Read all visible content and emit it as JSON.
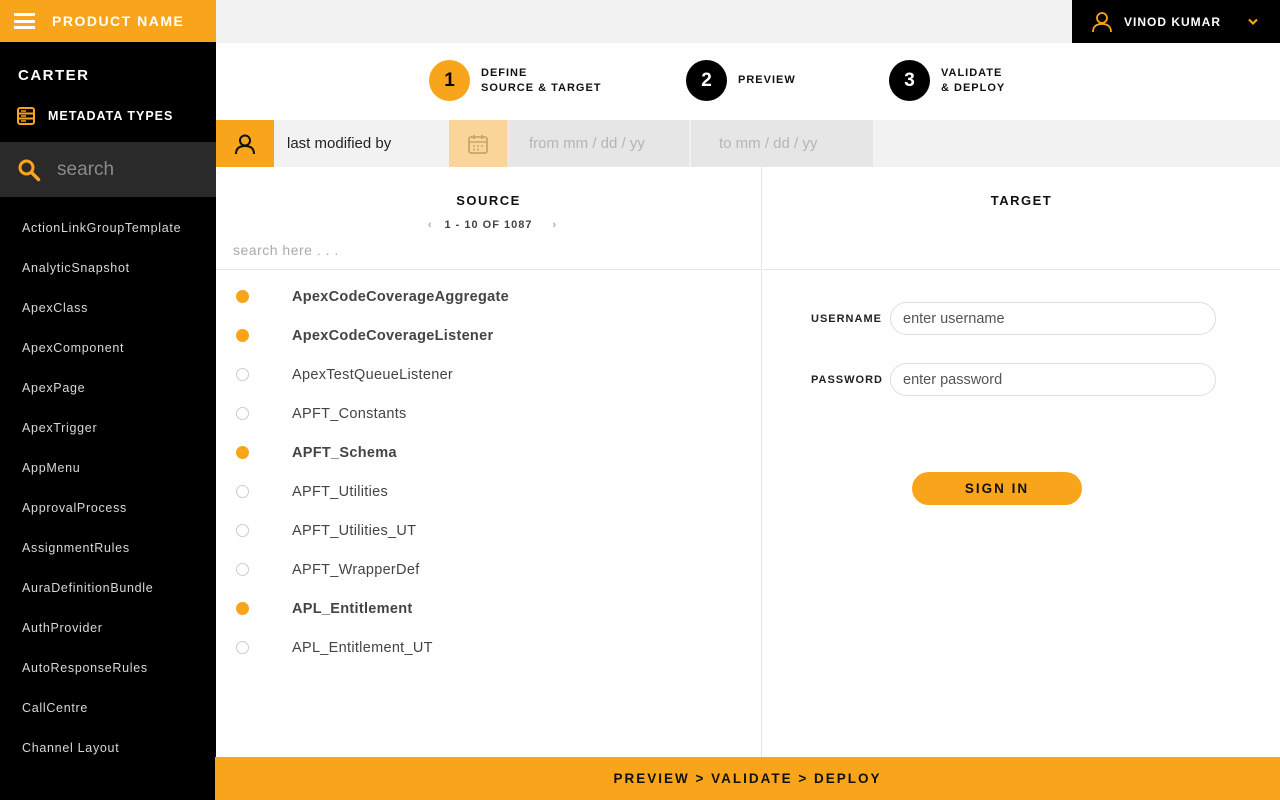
{
  "brand": {
    "product_name": "PRODUCT NAME"
  },
  "org": {
    "name": "CARTER"
  },
  "sidebar": {
    "section_label": "METADATA TYPES",
    "search_placeholder": "search",
    "types": [
      "ActionLinkGroupTemplate",
      "AnalyticSnapshot",
      "ApexClass",
      "ApexComponent",
      "ApexPage",
      "ApexTrigger",
      "AppMenu",
      "ApprovalProcess",
      "AssignmentRules",
      "AuraDefinitionBundle",
      "AuthProvider",
      "AutoResponseRules",
      "CallCentre",
      "Channel Layout"
    ]
  },
  "user": {
    "name": "VINOD KUMAR"
  },
  "steps": [
    {
      "number": "1",
      "line1": "DEFINE",
      "line2": "SOURCE & TARGET",
      "active": true
    },
    {
      "number": "2",
      "line1": "PREVIEW",
      "line2": "",
      "active": false
    },
    {
      "number": "3",
      "line1": "VALIDATE",
      "line2": "& DEPLOY",
      "active": false
    }
  ],
  "filter": {
    "last_modified_by": "last modified by",
    "from_placeholder": "from mm / dd / yy",
    "to_placeholder": "to mm / dd / yy"
  },
  "source": {
    "title": "SOURCE",
    "pager": "1 - 10 OF 1087",
    "search_placeholder": "search here . . .",
    "items": [
      {
        "name": "ApexCodeCoverageAggregate",
        "selected": true
      },
      {
        "name": "ApexCodeCoverageListener",
        "selected": true
      },
      {
        "name": "ApexTestQueueListener",
        "selected": false
      },
      {
        "name": "APFT_Constants",
        "selected": false
      },
      {
        "name": "APFT_Schema",
        "selected": true
      },
      {
        "name": "APFT_Utilities",
        "selected": false
      },
      {
        "name": "APFT_Utilities_UT",
        "selected": false
      },
      {
        "name": "APFT_WrapperDef",
        "selected": false
      },
      {
        "name": "APL_Entitlement",
        "selected": true
      },
      {
        "name": "APL_Entitlement_UT",
        "selected": false
      }
    ]
  },
  "target": {
    "title": "TARGET",
    "username_label": "USERNAME",
    "username_placeholder": "enter username",
    "password_label": "PASSWORD",
    "password_placeholder": "enter password",
    "signin_label": "SIGN IN"
  },
  "footer": {
    "label": "PREVIEW > VALIDATE > DEPLOY"
  },
  "colors": {
    "accent": "#f9a51b",
    "sidebar_bg": "#000000",
    "topbar_bg": "#f2f2f2"
  }
}
